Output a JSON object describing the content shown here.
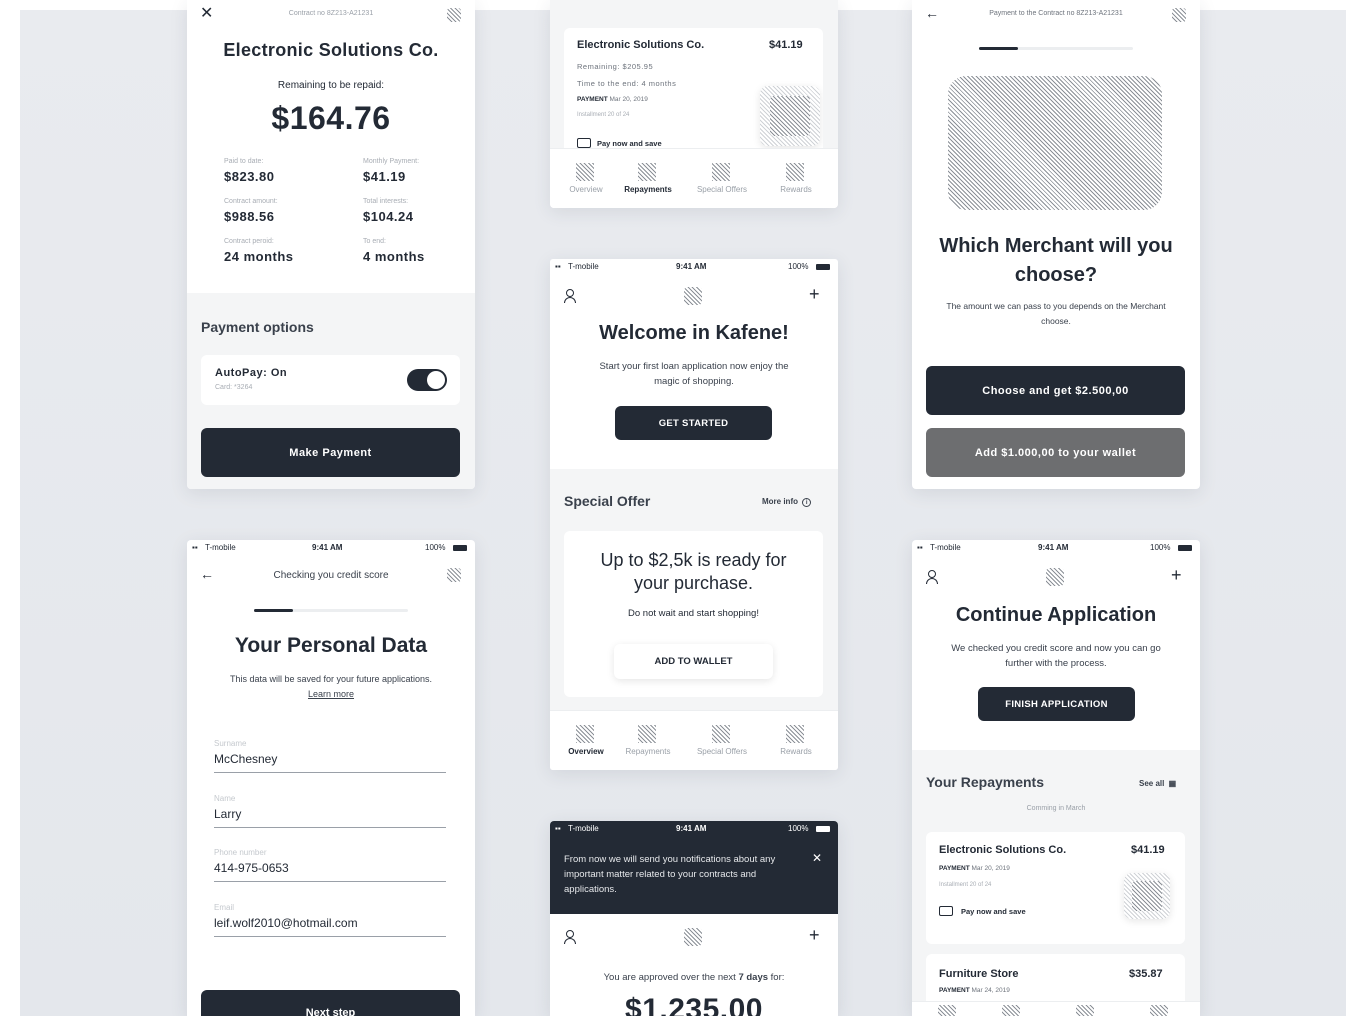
{
  "contract": {
    "contract_no": "Contract no 8Z213-A21231",
    "company": "Electronic Solutions Co.",
    "remaining_label": "Remaining to be repaid:",
    "remaining_value": "$164.76",
    "stats": [
      {
        "label": "Paid to date:",
        "value": "$823.80"
      },
      {
        "label": "Monthly Payment:",
        "value": "$41.19"
      },
      {
        "label": "Contract amount:",
        "value": "$988.56"
      },
      {
        "label": "Total interests:",
        "value": "$104.24"
      },
      {
        "label": "Contract peroid:",
        "value": "24 months"
      },
      {
        "label": "To end:",
        "value": "4 months"
      }
    ],
    "payment_options_title": "Payment options",
    "autopay_label": "AutoPay: On",
    "autopay_card": "Card: *3264",
    "autopay_on": true,
    "make_payment": "Make Payment"
  },
  "personal": {
    "status": {
      "carrier": "T-mobile",
      "time": "9:41 AM",
      "battery": "100%"
    },
    "header": "Checking you credit score",
    "progress": 0.25,
    "title": "Your Personal Data",
    "subtitle": "This data will be saved for your future applications.",
    "learn_more": "Learn more",
    "fields": [
      {
        "label": "Surname",
        "value": "McChesney"
      },
      {
        "label": "Name",
        "value": "Larry"
      },
      {
        "label": "Phone number",
        "value": "414-975-0653"
      },
      {
        "label": "Email",
        "value": "leif.wolf2010@hotmail.com"
      }
    ],
    "next_step": "Next step"
  },
  "repay_top": {
    "company": "Electronic Solutions Co.",
    "amount": "$41.19",
    "remaining": "Remaining: $205.95",
    "time_to_end": "Time to the end: 4 months",
    "payment": "PAYMENT",
    "payment_date": "Mar 20, 2019",
    "installment": "Installment 20 of 24",
    "pay_now": "Pay now and save",
    "tabs": [
      "Overview",
      "Repayments",
      "Special Offers",
      "Rewards"
    ],
    "active_tab": "Repayments"
  },
  "welcome": {
    "status": {
      "carrier": "T-mobile",
      "time": "9:41 AM",
      "battery": "100%"
    },
    "title": "Welcome in Kafene!",
    "subtitle": "Start your first loan application now enjoy the magic of shopping.",
    "cta": "GET STARTED",
    "special_offer": "Special Offer",
    "more_info": "More info",
    "offer_title": "Up to $2,5k is ready for your purchase.",
    "offer_sub": "Do not wait and start shopping!",
    "add_wallet": "ADD TO WALLET",
    "tabs": [
      "Overview",
      "Repayments",
      "Special Offers",
      "Rewards"
    ],
    "active_tab": "Overview"
  },
  "notif": {
    "status": {
      "carrier": "T-mobile",
      "time": "9:41 AM",
      "battery": "100%"
    },
    "banner": "From now we will send you notifications about any important matter related to your contracts and applications.",
    "approved_prefix": "You are approved over the next ",
    "approved_days": "7 days",
    "approved_suffix": " for:",
    "amount": "$1,235.00"
  },
  "merchant": {
    "header": "Payment to the Contract no 8Z213-A21231",
    "progress": 0.25,
    "title": "Which Merchant will you choose?",
    "subtitle": "The amount we can pass to you depends on the Merchant choose.",
    "choose": "Choose and get $2.500,00",
    "add_wallet": "Add $1.000,00 to your wallet"
  },
  "cont": {
    "status": {
      "carrier": "T-mobile",
      "time": "9:41 AM",
      "battery": "100%"
    },
    "title": "Continue Application",
    "subtitle": "We checked you credit score and now you can go further with the process.",
    "cta": "FINISH APPLICATION",
    "repayments_title": "Your Repayments",
    "see_all": "See all",
    "coming": "Comming in March",
    "company": "Electronic Solutions Co.",
    "amount": "$41.19",
    "payment": "PAYMENT",
    "payment_date": "Mar 20, 2019",
    "installment": "Installment 20 of 24",
    "pay_now": "Pay now and save",
    "company2": "Furniture Store",
    "amount2": "$35.87",
    "payment2": "PAYMENT",
    "payment_date2": "Mar 24, 2019"
  }
}
